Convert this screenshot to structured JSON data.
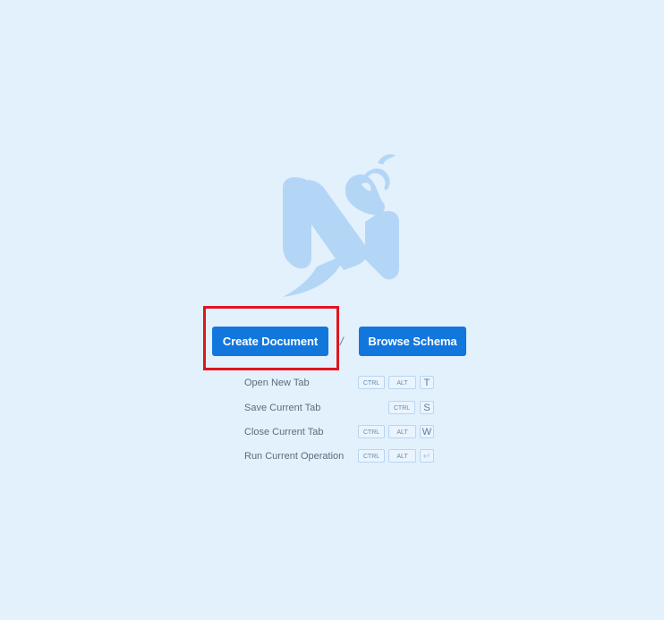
{
  "actions": {
    "create_label": "Create Document",
    "separator": "/",
    "browse_label": "Browse Schema"
  },
  "shortcuts": [
    {
      "label": "Open New Tab",
      "keys": [
        "CTRL",
        "ALT",
        "T"
      ]
    },
    {
      "label": "Save Current Tab",
      "keys": [
        "CTRL",
        "S"
      ]
    },
    {
      "label": "Close Current Tab",
      "keys": [
        "CTRL",
        "ALT",
        "W"
      ]
    },
    {
      "label": "Run Current Operation",
      "keys": [
        "CTRL",
        "ALT"
      ],
      "key_icon": "enter-key-icon"
    }
  ],
  "colors": {
    "background": "#e3f1fd",
    "primary": "#1277dd",
    "logo": "#b4d6f6",
    "highlight": "#e0141e"
  }
}
